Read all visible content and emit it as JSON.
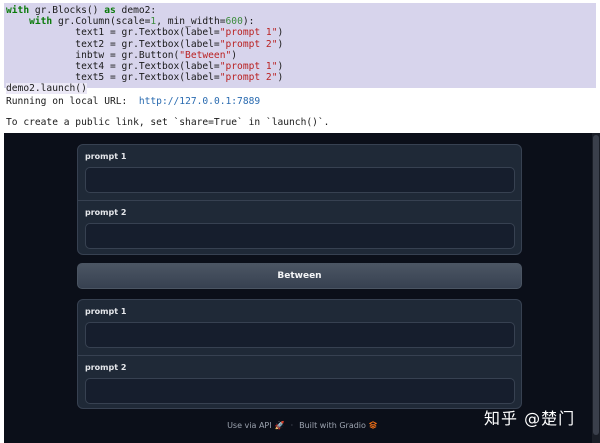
{
  "code_cell": {
    "lines": [
      [
        {
          "t": "with",
          "c": "kw"
        },
        {
          "t": " gr.Blocks() ",
          "c": ""
        },
        {
          "t": "as",
          "c": "kw"
        },
        {
          "t": " demo2:",
          "c": ""
        }
      ],
      [
        {
          "t": "    ",
          "c": ""
        },
        {
          "t": "with",
          "c": "kw"
        },
        {
          "t": " gr.Column(scale=",
          "c": ""
        },
        {
          "t": "1",
          "c": "num"
        },
        {
          "t": ", min_width=",
          "c": ""
        },
        {
          "t": "600",
          "c": "num"
        },
        {
          "t": "):",
          "c": ""
        }
      ],
      [
        {
          "t": "            text1 = gr.Textbox(label=",
          "c": ""
        },
        {
          "t": "\"prompt 1\"",
          "c": "str"
        },
        {
          "t": ")",
          "c": ""
        }
      ],
      [
        {
          "t": "            text2 = gr.Textbox(label=",
          "c": ""
        },
        {
          "t": "\"prompt 2\"",
          "c": "str"
        },
        {
          "t": ")",
          "c": ""
        }
      ],
      [
        {
          "t": "            inbtw = gr.Button(",
          "c": ""
        },
        {
          "t": "\"Between\"",
          "c": "str"
        },
        {
          "t": ")",
          "c": ""
        }
      ],
      [
        {
          "t": "            text4 = gr.Textbox(label=",
          "c": ""
        },
        {
          "t": "\"prompt 1\"",
          "c": "str"
        },
        {
          "t": ")",
          "c": ""
        }
      ],
      [
        {
          "t": "            text5 = gr.Textbox(label=",
          "c": ""
        },
        {
          "t": "\"prompt 2\"",
          "c": "str"
        },
        {
          "t": ")",
          "c": ""
        }
      ],
      [
        {
          "t": "demo2.launch()",
          "c": "launch-highlight"
        }
      ]
    ]
  },
  "output": {
    "running_prefix": "Running on local URL:  ",
    "local_url": "http://127.0.0.1:7889",
    "public_link_note": "To create a public link, set `share=True` in `launch()`."
  },
  "app": {
    "group_1": {
      "textbox_1": {
        "label": "prompt 1",
        "value": ""
      },
      "textbox_2": {
        "label": "prompt 2",
        "value": ""
      }
    },
    "button": {
      "label": "Between"
    },
    "group_2": {
      "textbox_1": {
        "label": "prompt 1",
        "value": ""
      },
      "textbox_2": {
        "label": "prompt 2",
        "value": ""
      }
    },
    "footer": {
      "use_api": "Use via API",
      "separator": "·",
      "built_with": "Built with Gradio",
      "rocket_icon": "rocket-icon",
      "gradio_icon": "gradio-logo-icon"
    }
  },
  "watermark": "知乎 @楚门",
  "colors": {
    "code_bg": "#d7d4ec",
    "app_bg": "#0b0f19",
    "panel_bg": "#1f2937",
    "keyword": "#0a7a0a",
    "string": "#ba2121",
    "link": "#2a6bb0"
  }
}
